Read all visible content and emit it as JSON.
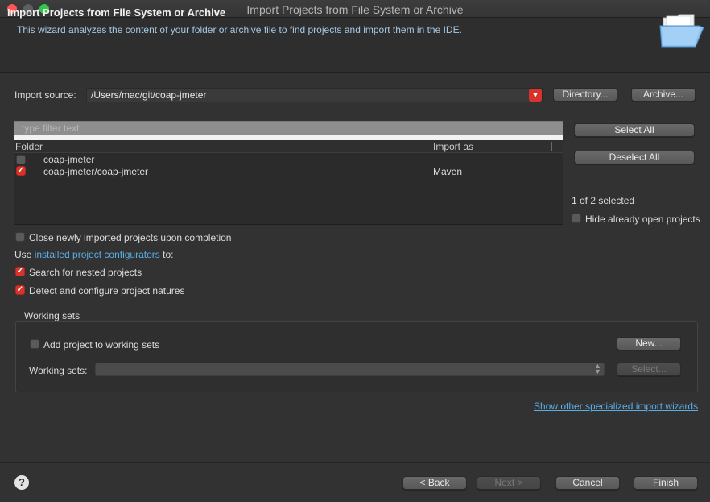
{
  "window": {
    "title": "Import Projects from File System or Archive"
  },
  "banner": {
    "title": "Import Projects from File System or Archive",
    "description": "This wizard analyzes the content of your folder or archive file to find projects and import them in the IDE."
  },
  "import_source": {
    "label": "Import source:",
    "value": "/Users/mac/git/coap-jmeter",
    "directory_button": "Directory...",
    "archive_button": "Archive..."
  },
  "filter": {
    "placeholder": "type filter text"
  },
  "table": {
    "columns": [
      "Folder",
      "Import as"
    ],
    "rows": [
      {
        "folder": "coap-jmeter",
        "import_as": "",
        "checked": false
      },
      {
        "folder": "coap-jmeter/coap-jmeter",
        "import_as": "Maven",
        "checked": true
      }
    ]
  },
  "side": {
    "select_all": "Select All",
    "deselect_all": "Deselect All",
    "selected_count": "1 of 2 selected",
    "hide_open": "Hide already open projects",
    "hide_open_checked": false
  },
  "options": {
    "close_imported": "Close newly imported projects upon completion",
    "close_imported_checked": false,
    "use_prefix": "Use",
    "configurators_link": "installed project configurators",
    "use_suffix": "to:",
    "search_nested": "Search for nested projects",
    "search_nested_checked": true,
    "detect_natures": "Detect and configure project natures",
    "detect_natures_checked": true
  },
  "working_sets": {
    "group_title": "Working sets",
    "add_label": "Add project to working sets",
    "add_checked": false,
    "new_button": "New...",
    "sets_label": "Working sets:",
    "select_button": "Select..."
  },
  "other_wizards_link": "Show other specialized import wizards",
  "footer": {
    "help": "?",
    "back": "< Back",
    "next": "Next >",
    "cancel": "Cancel",
    "finish": "Finish"
  },
  "colors": {
    "accent_checkbox": "#d8342e",
    "link": "#5aaee8",
    "background": "#323232"
  }
}
